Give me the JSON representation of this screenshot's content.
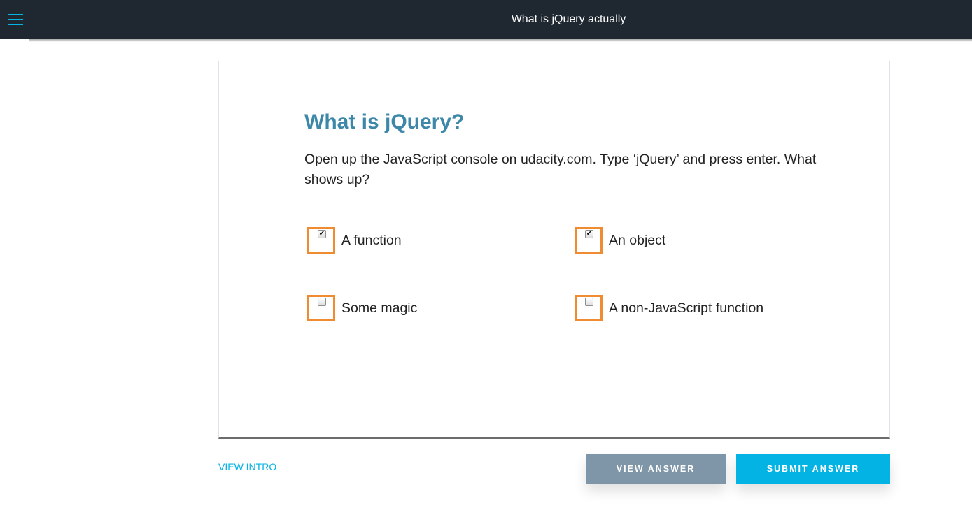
{
  "header": {
    "title": "What is jQuery actually",
    "menu_icon": "hamburger-menu-icon"
  },
  "quiz": {
    "heading": "What is jQuery?",
    "prompt": "Open up the JavaScript console on udacity.com. Type ‘jQuery’ and press enter. What shows up?",
    "options": [
      {
        "label": "A function",
        "checked": true
      },
      {
        "label": "An object",
        "checked": true
      },
      {
        "label": "Some magic",
        "checked": false
      },
      {
        "label": "A non-JavaScript function",
        "checked": false
      }
    ]
  },
  "footer": {
    "view_intro": "VIEW INTRO",
    "view_answer": "VIEW ANSWER",
    "submit_answer": "SUBMIT ANSWER"
  },
  "colors": {
    "header_bg": "#1f2731",
    "accent": "#02b3e4",
    "heading": "#3d88a8",
    "option_border": "#ef8c32",
    "view_answer_bg": "#7f96a8"
  }
}
